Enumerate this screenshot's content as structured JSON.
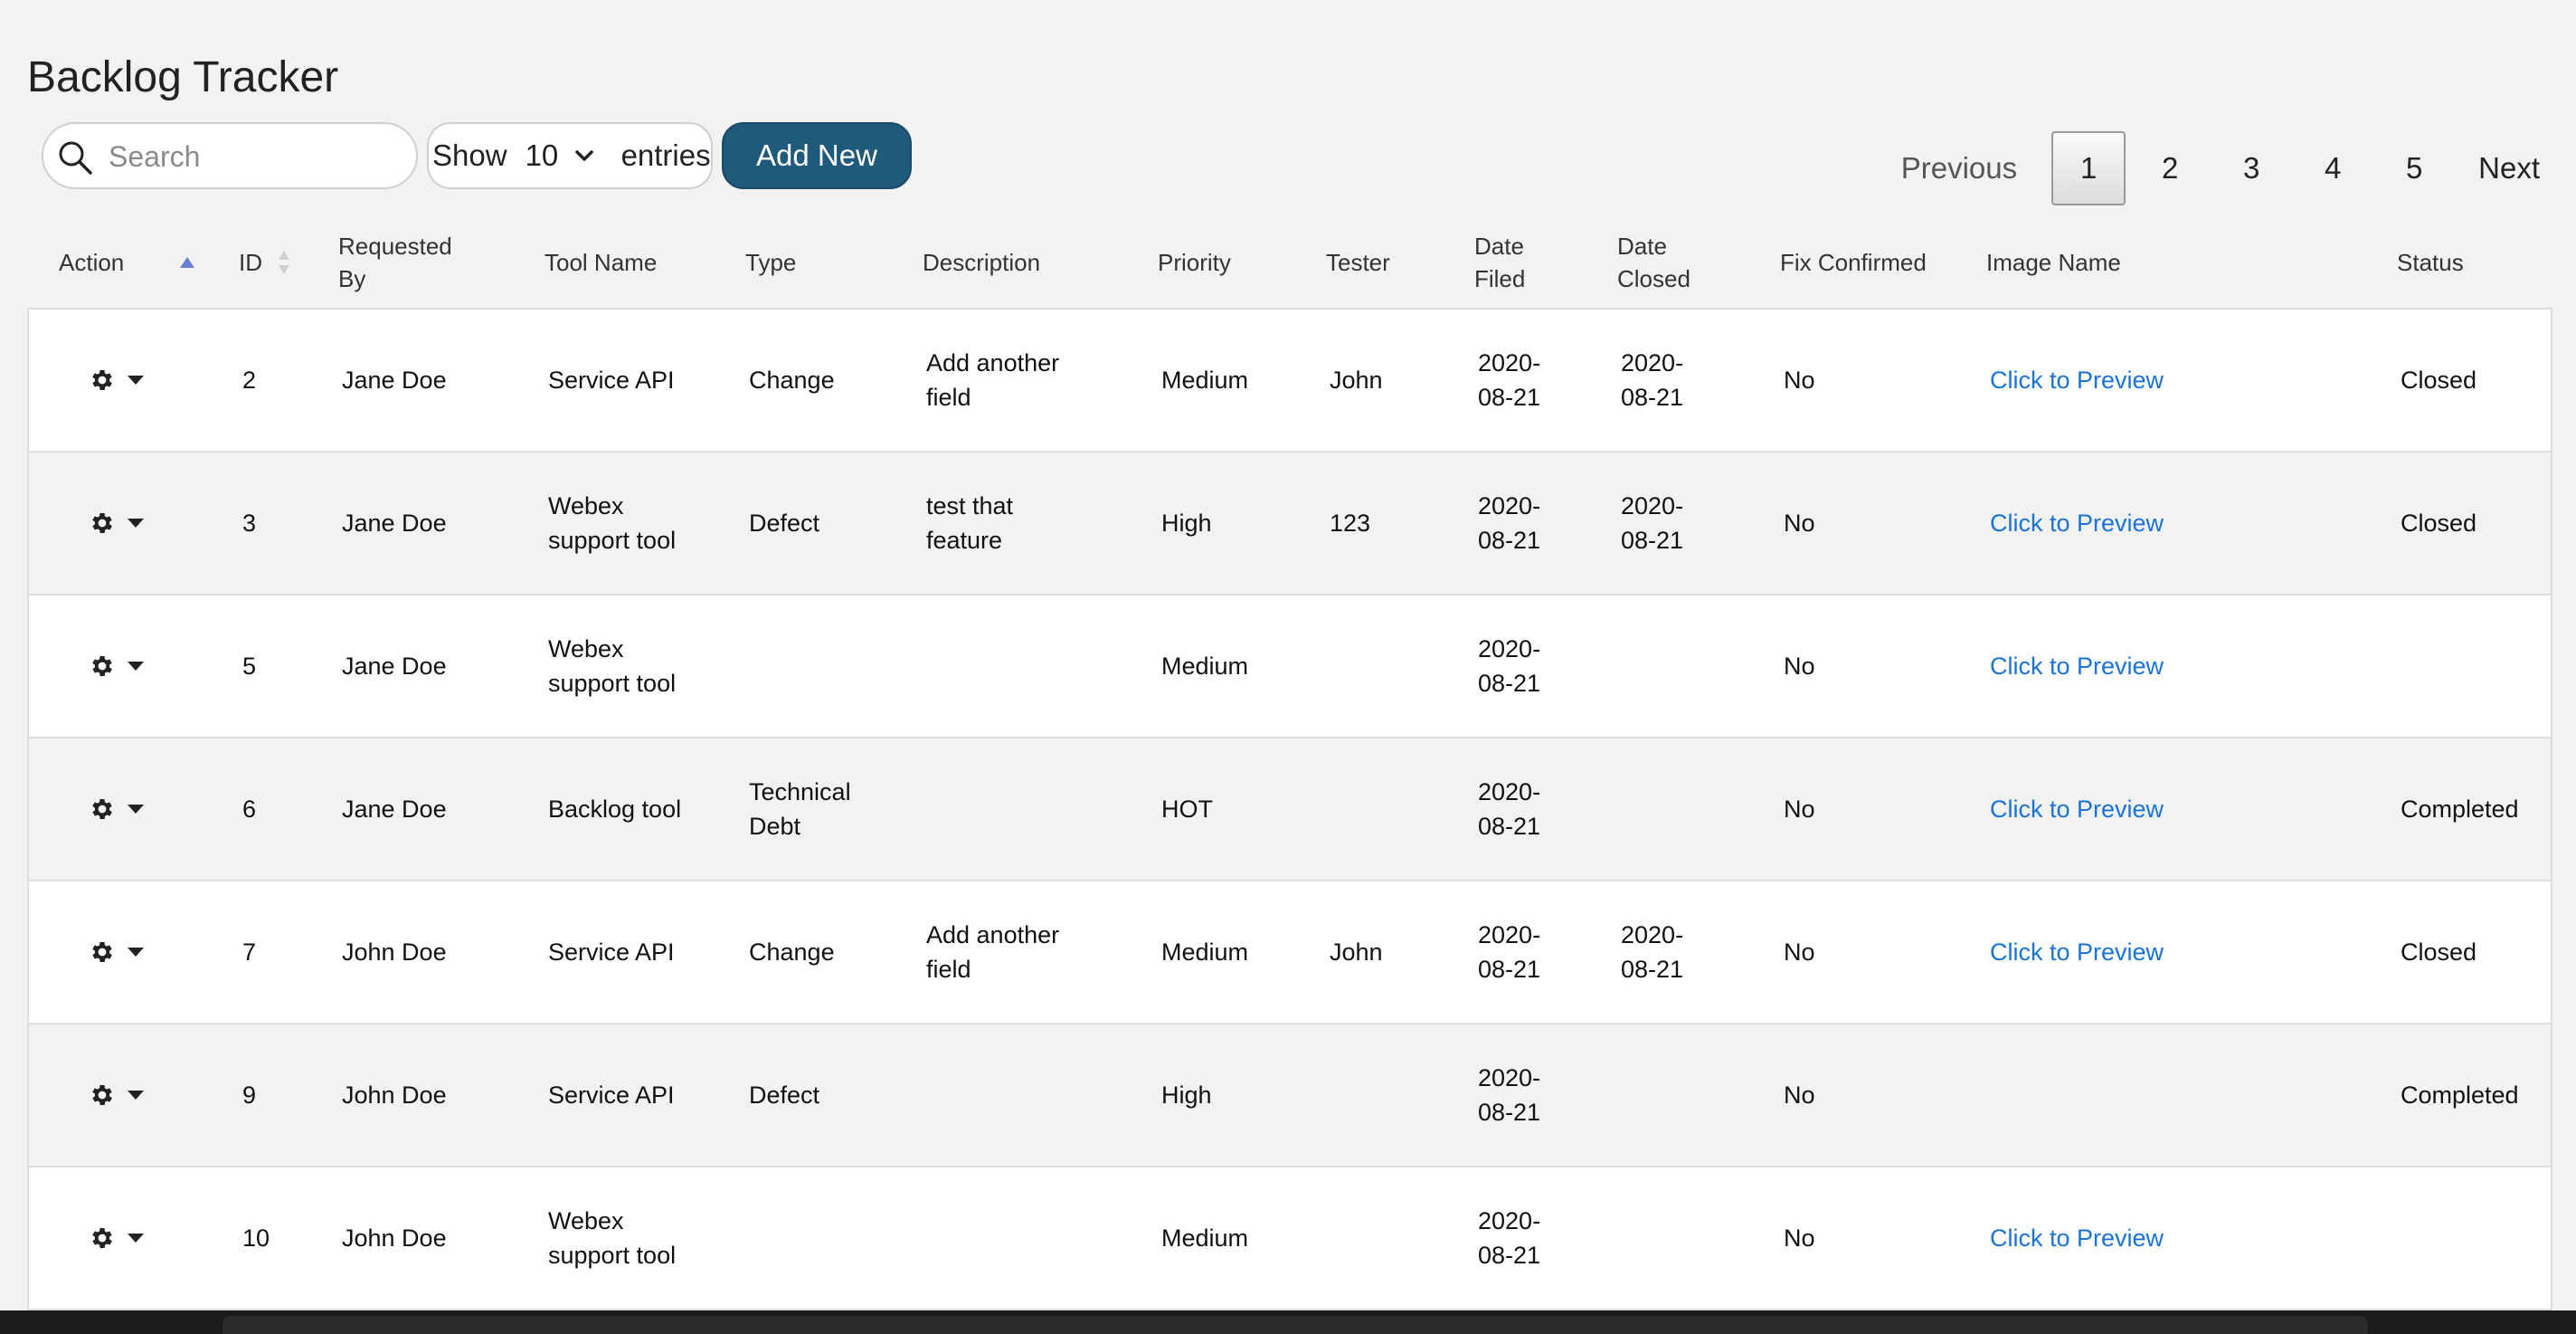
{
  "title": "Backlog Tracker",
  "search": {
    "placeholder": "Search",
    "value": ""
  },
  "entries": {
    "show_label": "Show",
    "selected": "10",
    "entries_label": "entries"
  },
  "add_button": "Add New",
  "pagination": {
    "previous": "Previous",
    "pages": [
      "1",
      "2",
      "3",
      "4",
      "5"
    ],
    "active": "1",
    "next": "Next"
  },
  "columns": {
    "action": "Action",
    "id": "ID",
    "requested_by": [
      "Requested",
      "By"
    ],
    "tool_name": "Tool Name",
    "type": "Type",
    "description": "Description",
    "priority": "Priority",
    "tester": "Tester",
    "date_filed": [
      "Date",
      "Filed"
    ],
    "date_closed": [
      "Date",
      "Closed"
    ],
    "fix_confirmed": "Fix Confirmed",
    "image_name": "Image Name",
    "status": "Status"
  },
  "rows": [
    {
      "id": "2",
      "requested_by": "Jane Doe",
      "tool": [
        "Service API"
      ],
      "type": [
        "Change"
      ],
      "description": [
        "Add another",
        "field"
      ],
      "priority": "Medium",
      "tester": "John",
      "date_filed": [
        "2020-",
        "08-21"
      ],
      "date_closed": [
        "2020-",
        "08-21"
      ],
      "fix_confirmed": "No",
      "image": "Click to Preview",
      "status": "Closed"
    },
    {
      "id": "3",
      "requested_by": "Jane Doe",
      "tool": [
        "Webex",
        "support tool"
      ],
      "type": [
        "Defect"
      ],
      "description": [
        "test that",
        "feature"
      ],
      "priority": "High",
      "tester": "123",
      "date_filed": [
        "2020-",
        "08-21"
      ],
      "date_closed": [
        "2020-",
        "08-21"
      ],
      "fix_confirmed": "No",
      "image": "Click to Preview",
      "status": "Closed"
    },
    {
      "id": "5",
      "requested_by": "Jane Doe",
      "tool": [
        "Webex",
        "support tool"
      ],
      "type": [],
      "description": [],
      "priority": "Medium",
      "tester": "",
      "date_filed": [
        "2020-",
        "08-21"
      ],
      "date_closed": [],
      "fix_confirmed": "No",
      "image": "Click to Preview",
      "status": ""
    },
    {
      "id": "6",
      "requested_by": "Jane Doe",
      "tool": [
        "Backlog tool"
      ],
      "type": [
        "Technical",
        "Debt"
      ],
      "description": [],
      "priority": "HOT",
      "tester": "",
      "date_filed": [
        "2020-",
        "08-21"
      ],
      "date_closed": [],
      "fix_confirmed": "No",
      "image": "Click to Preview",
      "status": "Completed"
    },
    {
      "id": "7",
      "requested_by": "John Doe",
      "tool": [
        "Service API"
      ],
      "type": [
        "Change"
      ],
      "description": [
        "Add another",
        "field"
      ],
      "priority": "Medium",
      "tester": "John",
      "date_filed": [
        "2020-",
        "08-21"
      ],
      "date_closed": [
        "2020-",
        "08-21"
      ],
      "fix_confirmed": "No",
      "image": "Click to Preview",
      "status": "Closed"
    },
    {
      "id": "9",
      "requested_by": "John Doe",
      "tool": [
        "Service API"
      ],
      "type": [
        "Defect"
      ],
      "description": [],
      "priority": "High",
      "tester": "",
      "date_filed": [
        "2020-",
        "08-21"
      ],
      "date_closed": [],
      "fix_confirmed": "No",
      "image": "",
      "status": "Completed"
    },
    {
      "id": "10",
      "requested_by": "John Doe",
      "tool": [
        "Webex",
        "support tool"
      ],
      "type": [],
      "description": [],
      "priority": "Medium",
      "tester": "",
      "date_filed": [
        "2020-",
        "08-21"
      ],
      "date_closed": [],
      "fix_confirmed": "No",
      "image": "Click to Preview",
      "status": ""
    }
  ],
  "icons": {
    "search": "search-icon",
    "row_action": "gear-icon",
    "row_menu": "caret-down-icon",
    "select": "chevron-down-icon",
    "sort": "sort-icon"
  },
  "colors": {
    "button": "#1f5a7a",
    "link": "#1a73d9",
    "sort_active": "#6b7fd6",
    "row_alt": "#f2f2f2"
  }
}
